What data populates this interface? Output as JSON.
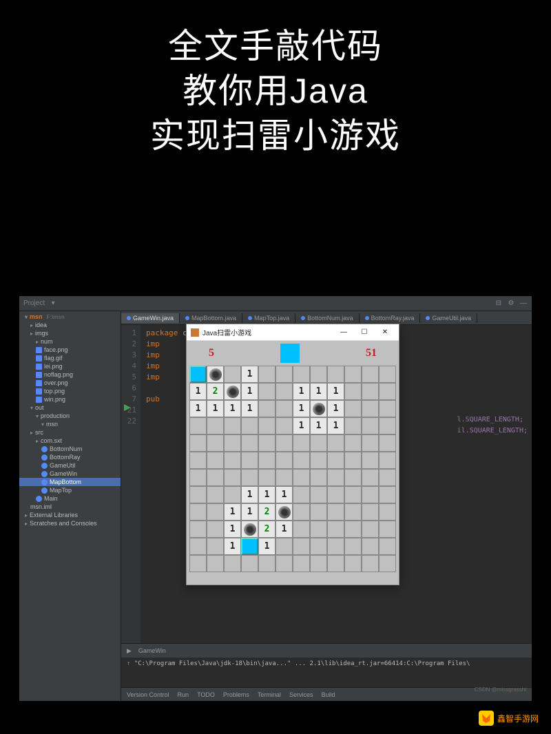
{
  "headline": {
    "l1": "全文手敲代码",
    "l2": "教你用Java",
    "l3": "实现扫雷小游戏"
  },
  "ide": {
    "project_label": "Project",
    "root": "msn",
    "root_hint": "F:\\msn",
    "tree": [
      {
        "t": "idea",
        "d": 1,
        "f": 1
      },
      {
        "t": "imgs",
        "d": 1,
        "f": 1
      },
      {
        "t": "num",
        "d": 2,
        "f": 1
      },
      {
        "t": "face.png",
        "d": 2,
        "i": 1
      },
      {
        "t": "flag.gif",
        "d": 2,
        "i": 1
      },
      {
        "t": "lei.png",
        "d": 2,
        "i": 1
      },
      {
        "t": "noflag.png",
        "d": 2,
        "i": 1
      },
      {
        "t": "over.png",
        "d": 2,
        "i": 1
      },
      {
        "t": "top.png",
        "d": 2,
        "i": 1
      },
      {
        "t": "win.png",
        "d": 2,
        "i": 1
      },
      {
        "t": "out",
        "d": 1,
        "f": 1,
        "o": 1
      },
      {
        "t": "production",
        "d": 2,
        "f": 1,
        "o": 1
      },
      {
        "t": "msn",
        "d": 3,
        "f": 1,
        "o": 1
      },
      {
        "t": "src",
        "d": 1,
        "f": 1
      },
      {
        "t": "com.sxt",
        "d": 2,
        "f": 1
      },
      {
        "t": "BottomNum",
        "d": 3,
        "c": 1
      },
      {
        "t": "BottomRay",
        "d": 3,
        "c": 1
      },
      {
        "t": "GameUtil",
        "d": 3,
        "c": 1
      },
      {
        "t": "GameWin",
        "d": 3,
        "c": 1
      },
      {
        "t": "MapBottom",
        "d": 3,
        "c": 1,
        "sel": 1
      },
      {
        "t": "MapTop",
        "d": 3,
        "c": 1
      },
      {
        "t": "Main",
        "d": 2,
        "c": 1
      },
      {
        "t": "msn.iml",
        "d": 1
      },
      {
        "t": "External Libraries",
        "d": 0,
        "f": 1
      },
      {
        "t": "Scratches and Consoles",
        "d": 0,
        "f": 1
      }
    ],
    "tabs": [
      {
        "label": "GameWin.java",
        "active": true
      },
      {
        "label": "MapBottom.java"
      },
      {
        "label": "MapTop.java"
      },
      {
        "label": "BottomNum.java"
      },
      {
        "label": "BottomRay.java"
      },
      {
        "label": "GameUtil.java"
      }
    ],
    "gutter": [
      "1",
      "2",
      "3",
      "4",
      "5",
      "6",
      "7",
      " ",
      "",
      "",
      "",
      "",
      "",
      "",
      "",
      "",
      "",
      "",
      "",
      "",
      "21",
      "22"
    ],
    "code_l1": "package com.sxt;",
    "code_imp": "imp",
    "code_pub": "pub",
    "code_right_1": "l.SQUARE_LENGTH;",
    "code_right_2": "il.SQUARE_LENGTH;",
    "console_tab": "GameWin",
    "console_line": "\"C:\\Program Files\\Java\\jdk-18\\bin\\java...\"  ... 2.1\\lib\\idea_rt.jar=66414:C:\\Program Files\\",
    "bottom": [
      "Version Control",
      "Run",
      "TODO",
      "Problems",
      "Terminal",
      "Services",
      "Build"
    ]
  },
  "game": {
    "title": "Java扫雷小游戏",
    "mines": "5",
    "time": "51",
    "grid": [
      [
        "c",
        "m",
        "",
        "1",
        "",
        "",
        "",
        "",
        "",
        "",
        "",
        ""
      ],
      [
        "1",
        "2",
        "m",
        "1",
        "",
        "",
        "1",
        "1",
        "1",
        "",
        "",
        ""
      ],
      [
        "1",
        "1",
        "1",
        "1",
        "",
        "",
        "1",
        "m",
        "1",
        "",
        "",
        ""
      ],
      [
        "",
        "",
        "",
        "",
        "",
        "",
        "1",
        "1",
        "1",
        "",
        "",
        ""
      ],
      [
        "",
        "",
        "",
        "",
        "",
        "",
        "",
        "",
        "",
        "",
        "",
        ""
      ],
      [
        "",
        "",
        "",
        "",
        "",
        "",
        "",
        "",
        "",
        "",
        "",
        ""
      ],
      [
        "",
        "",
        "",
        "",
        "",
        "",
        "",
        "",
        "",
        "",
        "",
        ""
      ],
      [
        "",
        "",
        "",
        "1",
        "1",
        "1",
        "",
        "",
        "",
        "",
        "",
        ""
      ],
      [
        "",
        "",
        "1",
        "1",
        "2",
        "m",
        "",
        "",
        "",
        "",
        "",
        ""
      ],
      [
        "",
        "",
        "1",
        "m",
        "2",
        "1",
        "",
        "",
        "",
        "",
        "",
        ""
      ],
      [
        "",
        "",
        "1",
        "c",
        "1",
        "",
        "",
        "",
        "",
        "",
        "",
        ""
      ],
      [
        "",
        "",
        "",
        "",
        "",
        "",
        "",
        "",
        "",
        "",
        "",
        ""
      ]
    ]
  },
  "watermark": "鑫智手游网",
  "csdnmark": "CSDN @missgrasshi"
}
